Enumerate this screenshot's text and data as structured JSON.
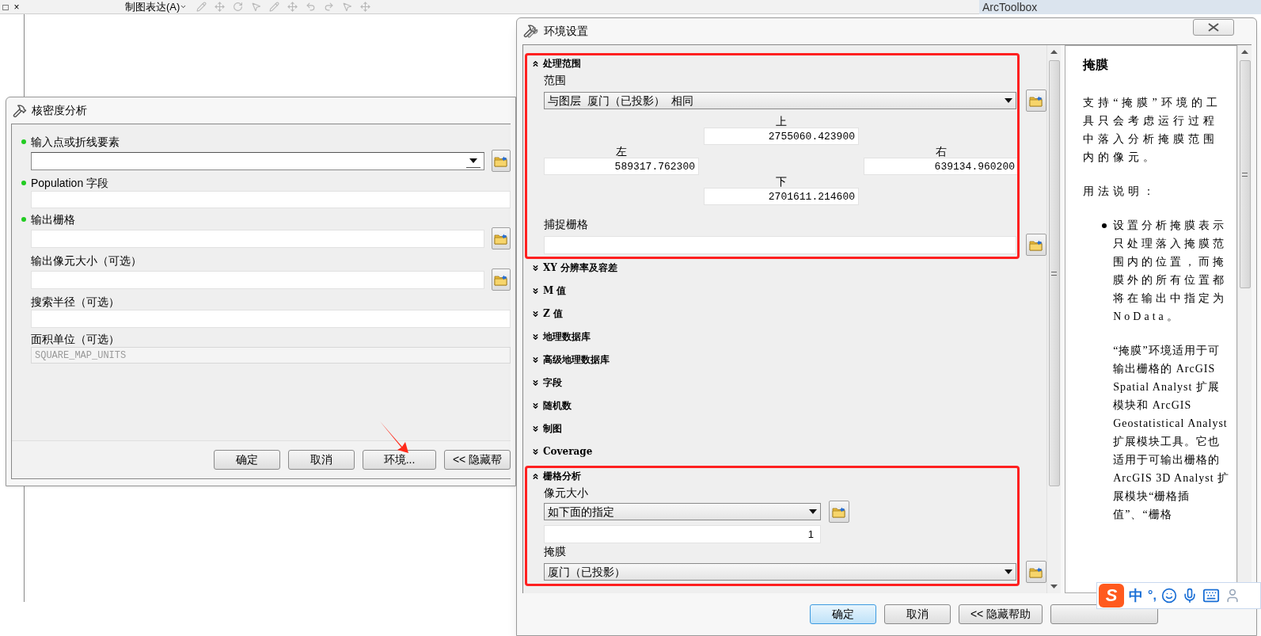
{
  "app": {
    "window_buttons": [
      "□",
      "×"
    ],
    "menu": "制图表达(A)",
    "toolbox_title": "ArcToolbox"
  },
  "kernel_dialog": {
    "title": "核密度分析",
    "params": [
      {
        "label": "输入点或折线要素",
        "required": true,
        "kind": "combo",
        "browse": true
      },
      {
        "label": "Population 字段",
        "required": true,
        "kind": "flat_combo",
        "browse": false
      },
      {
        "label": "输出栅格",
        "required": true,
        "kind": "input",
        "browse": true
      },
      {
        "label": "输出像元大小（可选）",
        "required": false,
        "kind": "input",
        "browse": true
      },
      {
        "label": "搜索半径（可选）",
        "required": false,
        "kind": "input",
        "browse": false
      },
      {
        "label": "面积单位（可选）",
        "required": false,
        "kind": "disabled_combo",
        "value": "SQUARE_MAP_UNITS",
        "browse": false
      }
    ],
    "buttons": [
      "确定",
      "取消",
      "环境...",
      "<< 隐藏帮"
    ]
  },
  "env_dialog": {
    "title": "环境设置",
    "sections": [
      {
        "title": "处理范围",
        "expanded": true,
        "highlighted": true,
        "fields": [
          {
            "kind": "combo",
            "label": "范围",
            "value": "与图层  厦门（已投影）  相同",
            "browse": true
          },
          {
            "kind": "extent",
            "top": {
              "label": "上",
              "value": "2755060.423900"
            },
            "left": {
              "label": "左",
              "value": "589317.762300"
            },
            "right": {
              "label": "右",
              "value": "639134.960200"
            },
            "bottom": {
              "label": "下",
              "value": "2701611.214600"
            }
          },
          {
            "kind": "input",
            "label": "捕捉栅格",
            "browse": true
          }
        ]
      },
      {
        "title": "XY 分辨率及容差",
        "expanded": false,
        "highlighted": false
      },
      {
        "title": "M 值",
        "expanded": false,
        "highlighted": false
      },
      {
        "title": "Z 值",
        "expanded": false,
        "highlighted": false
      },
      {
        "title": "地理数据库",
        "expanded": false,
        "highlighted": false
      },
      {
        "title": "高级地理数据库",
        "expanded": false,
        "highlighted": false
      },
      {
        "title": "字段",
        "expanded": false,
        "highlighted": false
      },
      {
        "title": "随机数",
        "expanded": false,
        "highlighted": false
      },
      {
        "title": "制图",
        "expanded": false,
        "highlighted": false
      },
      {
        "title": "Coverage",
        "expanded": false,
        "highlighted": false
      },
      {
        "title": "栅格分析",
        "expanded": true,
        "highlighted": true,
        "fields": [
          {
            "kind": "cell_size",
            "label": "像元大小",
            "value": "如下面的指定",
            "number": "1"
          },
          {
            "kind": "combo",
            "label": "掩膜",
            "value": "厦门（已投影）",
            "browse": true
          }
        ]
      }
    ],
    "help": [
      {
        "kind": "heading",
        "text": "掩膜"
      },
      {
        "kind": "paragraph",
        "text": "支持“掩膜”环境的工具只会考虑运行过程中落入分析掩膜范围内的像元。"
      },
      {
        "kind": "paragraph",
        "text": "用法说明："
      },
      {
        "kind": "bullet",
        "text": "设置分析掩膜表示只处理落入掩膜范围内的位置，而掩膜外的所有位置都将在输出中指定为 NoData。"
      },
      {
        "kind": "indented",
        "text": "“掩膜”环境适用于可输出栅格的 ArcGIS Spatial Analyst 扩展模块和 ArcGIS Geostatistical Analyst 扩展模块工具。它也适用于可输出栅格的 ArcGIS 3D Analyst 扩展模块“栅格插值”、“栅格"
      }
    ],
    "buttons": [
      {
        "label": "确定",
        "focused": true
      },
      {
        "label": "取消",
        "focused": false
      },
      {
        "label": "<< 隐藏帮助",
        "focused": false
      }
    ]
  },
  "ime_bar": {
    "logo": "S",
    "mode": "中",
    "punct": "°,"
  }
}
